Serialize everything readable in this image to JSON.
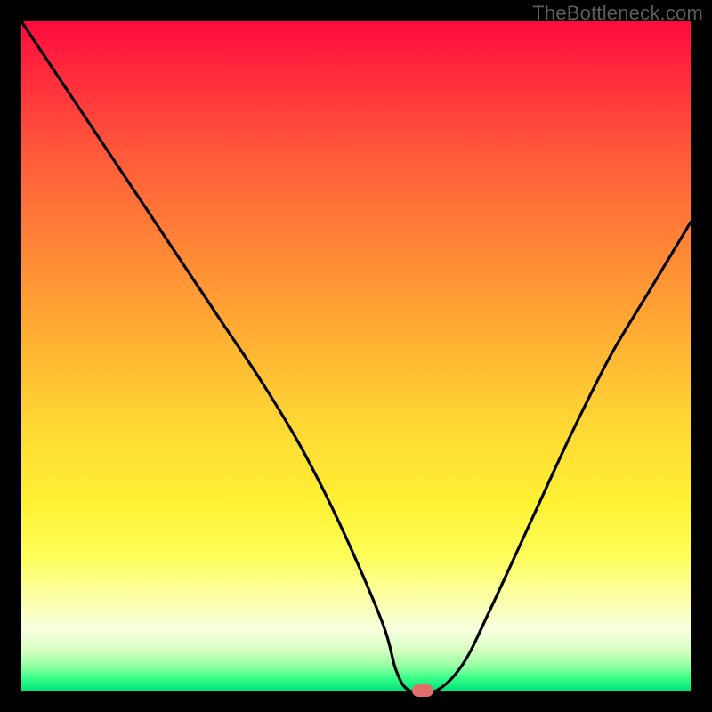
{
  "watermark": "TheBottleneck.com",
  "colors": {
    "accent_marker": "#e16f69",
    "curve": "#000000"
  },
  "chart_data": {
    "type": "line",
    "title": "",
    "xlabel": "",
    "ylabel": "",
    "xlim": [
      0,
      100
    ],
    "ylim": [
      0,
      100
    ],
    "grid": false,
    "legend": false,
    "series": [
      {
        "name": "bottleneck-curve",
        "x": [
          0,
          8,
          16,
          24,
          30,
          36,
          42,
          48,
          54,
          56,
          58,
          62,
          66,
          70,
          76,
          82,
          88,
          94,
          100
        ],
        "values": [
          100,
          88,
          76,
          64,
          55,
          46,
          36,
          24,
          10,
          3,
          0,
          0,
          4,
          12,
          25,
          38,
          50,
          60,
          70
        ]
      }
    ],
    "annotations": [
      {
        "name": "min-marker",
        "x": 60,
        "y": 0
      }
    ]
  }
}
